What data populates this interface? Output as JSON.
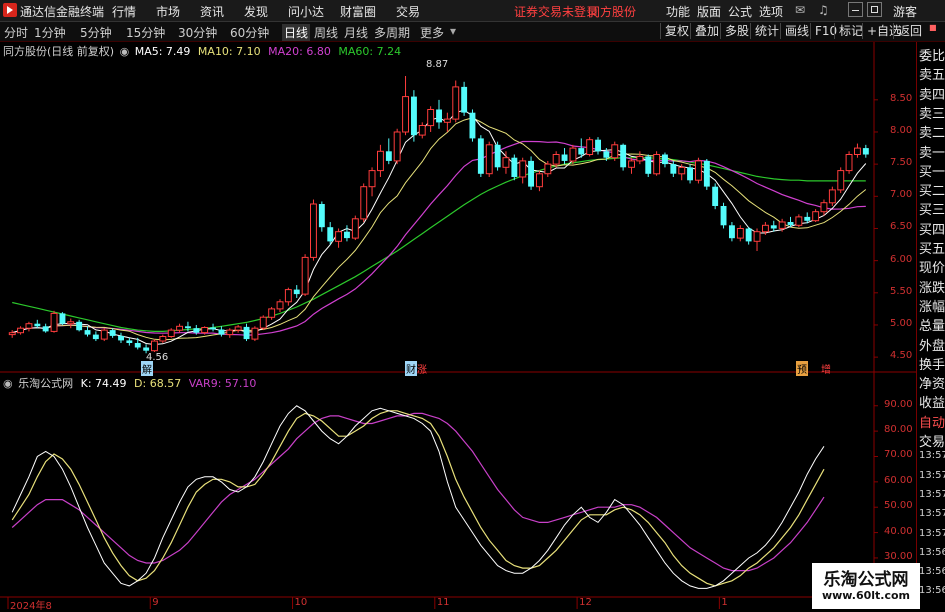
{
  "titlebar": {
    "app_name": "通达信金融终端",
    "menu": [
      "行情",
      "市场",
      "资讯",
      "发现",
      "问小达",
      "财富圈",
      "交易"
    ],
    "notice": "证券交易未登录",
    "stock": "同方股份",
    "right_menu": [
      "功能",
      "版面",
      "公式",
      "选项"
    ],
    "user": "游客"
  },
  "periodbar": {
    "periods": [
      "分时",
      "1分钟",
      "5分钟",
      "15分钟",
      "30分钟",
      "60分钟",
      "日线",
      "周线",
      "月线",
      "多周期",
      "更多"
    ],
    "active": "日线",
    "buttons": [
      "复权",
      "叠加",
      "多股",
      "统计",
      "画线",
      "F10",
      "标记",
      "+自选",
      "返回"
    ]
  },
  "main_legend": {
    "title": "同方股份(日线 前复权)",
    "ma5": "MA5: 7.49",
    "ma10": "MA10: 7.10",
    "ma20": "MA20: 6.80",
    "ma60": "MA60: 7.24"
  },
  "sub_legend": {
    "title": "乐淘公式网",
    "k": "K: 74.49",
    "d": "D: 68.57",
    "var9": "VAR9: 57.10"
  },
  "colors": {
    "up": "#ff3d3d",
    "down": "#54fcfc",
    "ma5": "#ffffff",
    "ma10": "#e6e07a",
    "ma20": "#d040d0",
    "ma60": "#2cc92c",
    "k": "#ffffff",
    "d": "#e8e07a",
    "var9": "#c840c8"
  },
  "right_panel": [
    "委比",
    "卖五",
    "卖四",
    "卖三",
    "卖二",
    "卖一",
    "买一",
    "买二",
    "买三",
    "买四",
    "买五",
    "现价",
    "涨跌",
    "涨幅",
    "总量",
    "外盘",
    "换手",
    "净资",
    "收益",
    "自动",
    "交易",
    "13:57",
    "13:57",
    "13:57",
    "13:57",
    "13:57",
    "13:56",
    "13:56",
    "13:56"
  ],
  "price_axis": [
    "8.50",
    "8.00",
    "7.50",
    "7.00",
    "6.50",
    "6.00",
    "5.50",
    "5.00",
    "4.50"
  ],
  "osc_axis": [
    "90.00",
    "80.00",
    "70.00",
    "60.00",
    "50.00",
    "40.00",
    "30.00"
  ],
  "date_axis": [
    "2024年8",
    "9",
    "10",
    "11",
    "12",
    "1"
  ],
  "annotations": {
    "high": "8.87",
    "low": "4.56",
    "marker_jie": "解",
    "marker_cai": "财",
    "marker_zhang": "涨",
    "marker_yu": "预",
    "marker_zeng": "增"
  },
  "watermark": {
    "line1": "乐淘公式网",
    "line2": "www.60lt.com"
  },
  "chart_data": {
    "type": "candlestick",
    "ylim": [
      4.3,
      9.15
    ],
    "osc_ylim": [
      15,
      97
    ],
    "candles": [
      [
        4.85,
        4.92,
        4.8,
        4.88
      ],
      [
        4.88,
        4.98,
        4.85,
        4.95
      ],
      [
        4.95,
        5.05,
        4.9,
        5.02
      ],
      [
        5.02,
        5.08,
        4.95,
        4.98
      ],
      [
        4.98,
        5.02,
        4.88,
        4.9
      ],
      [
        4.9,
        5.22,
        4.88,
        5.18
      ],
      [
        5.18,
        5.2,
        5.0,
        5.02
      ],
      [
        5.02,
        5.1,
        4.95,
        5.05
      ],
      [
        5.05,
        5.08,
        4.9,
        4.92
      ],
      [
        4.92,
        4.98,
        4.82,
        4.85
      ],
      [
        4.85,
        4.9,
        4.75,
        4.78
      ],
      [
        4.78,
        4.95,
        4.75,
        4.92
      ],
      [
        4.92,
        4.95,
        4.8,
        4.83
      ],
      [
        4.83,
        4.88,
        4.72,
        4.76
      ],
      [
        4.76,
        4.8,
        4.68,
        4.72
      ],
      [
        4.72,
        4.8,
        4.62,
        4.65
      ],
      [
        4.65,
        4.7,
        4.56,
        4.6
      ],
      [
        4.6,
        4.78,
        4.58,
        4.75
      ],
      [
        4.75,
        4.85,
        4.72,
        4.82
      ],
      [
        4.82,
        4.95,
        4.8,
        4.92
      ],
      [
        4.92,
        5.02,
        4.88,
        4.98
      ],
      [
        4.98,
        5.05,
        4.9,
        4.95
      ],
      [
        4.95,
        5.0,
        4.85,
        4.88
      ],
      [
        4.88,
        4.98,
        4.85,
        4.96
      ],
      [
        4.96,
        5.02,
        4.9,
        4.93
      ],
      [
        4.93,
        4.98,
        4.82,
        4.85
      ],
      [
        4.85,
        4.95,
        4.8,
        4.92
      ],
      [
        4.92,
        5.0,
        4.88,
        4.97
      ],
      [
        4.97,
        5.02,
        4.75,
        4.78
      ],
      [
        4.78,
        4.98,
        4.75,
        4.95
      ],
      [
        4.95,
        5.15,
        4.92,
        5.12
      ],
      [
        5.12,
        5.28,
        5.08,
        5.25
      ],
      [
        5.25,
        5.4,
        5.2,
        5.36
      ],
      [
        5.36,
        5.58,
        5.3,
        5.55
      ],
      [
        5.55,
        5.62,
        5.42,
        5.48
      ],
      [
        5.48,
        6.1,
        5.45,
        6.05
      ],
      [
        6.05,
        6.95,
        6.0,
        6.88
      ],
      [
        6.88,
        6.92,
        6.45,
        6.52
      ],
      [
        6.52,
        6.6,
        6.25,
        6.3
      ],
      [
        6.3,
        6.5,
        6.2,
        6.45
      ],
      [
        6.45,
        6.55,
        6.3,
        6.35
      ],
      [
        6.35,
        6.7,
        6.32,
        6.65
      ],
      [
        6.65,
        7.2,
        6.6,
        7.15
      ],
      [
        7.15,
        7.45,
        7.0,
        7.4
      ],
      [
        7.4,
        7.8,
        7.3,
        7.7
      ],
      [
        7.7,
        7.9,
        7.5,
        7.55
      ],
      [
        7.55,
        8.05,
        7.5,
        8.0
      ],
      [
        8.0,
        8.87,
        7.95,
        8.55
      ],
      [
        8.55,
        8.65,
        7.85,
        7.95
      ],
      [
        7.95,
        8.15,
        7.9,
        8.1
      ],
      [
        8.1,
        8.4,
        8.0,
        8.35
      ],
      [
        8.35,
        8.5,
        8.05,
        8.15
      ],
      [
        8.15,
        8.3,
        8.0,
        8.2
      ],
      [
        8.2,
        8.8,
        8.15,
        8.7
      ],
      [
        8.7,
        8.78,
        8.25,
        8.3
      ],
      [
        8.3,
        8.35,
        7.85,
        7.9
      ],
      [
        7.9,
        7.95,
        7.3,
        7.35
      ],
      [
        7.35,
        7.85,
        7.3,
        7.8
      ],
      [
        7.8,
        7.85,
        7.4,
        7.45
      ],
      [
        7.45,
        7.7,
        7.35,
        7.6
      ],
      [
        7.6,
        7.65,
        7.25,
        7.3
      ],
      [
        7.3,
        7.6,
        7.2,
        7.55
      ],
      [
        7.55,
        7.62,
        7.1,
        7.15
      ],
      [
        7.15,
        7.4,
        7.08,
        7.35
      ],
      [
        7.35,
        7.55,
        7.3,
        7.5
      ],
      [
        7.5,
        7.7,
        7.45,
        7.65
      ],
      [
        7.65,
        7.75,
        7.5,
        7.55
      ],
      [
        7.55,
        7.8,
        7.5,
        7.75
      ],
      [
        7.75,
        7.9,
        7.6,
        7.65
      ],
      [
        7.65,
        7.92,
        7.62,
        7.88
      ],
      [
        7.88,
        7.92,
        7.65,
        7.7
      ],
      [
        7.7,
        7.75,
        7.55,
        7.6
      ],
      [
        7.6,
        7.85,
        7.55,
        7.8
      ],
      [
        7.8,
        7.82,
        7.4,
        7.45
      ],
      [
        7.45,
        7.6,
        7.35,
        7.55
      ],
      [
        7.55,
        7.7,
        7.5,
        7.62
      ],
      [
        7.62,
        7.65,
        7.3,
        7.35
      ],
      [
        7.35,
        7.7,
        7.32,
        7.65
      ],
      [
        7.65,
        7.68,
        7.45,
        7.5
      ],
      [
        7.5,
        7.55,
        7.3,
        7.35
      ],
      [
        7.35,
        7.5,
        7.25,
        7.45
      ],
      [
        7.45,
        7.5,
        7.2,
        7.25
      ],
      [
        7.25,
        7.6,
        7.2,
        7.55
      ],
      [
        7.55,
        7.58,
        7.1,
        7.15
      ],
      [
        7.15,
        7.2,
        6.8,
        6.85
      ],
      [
        6.85,
        6.9,
        6.5,
        6.55
      ],
      [
        6.55,
        6.6,
        6.3,
        6.35
      ],
      [
        6.35,
        6.55,
        6.3,
        6.5
      ],
      [
        6.5,
        6.52,
        6.25,
        6.3
      ],
      [
        6.3,
        6.5,
        6.15,
        6.45
      ],
      [
        6.45,
        6.6,
        6.4,
        6.55
      ],
      [
        6.55,
        6.62,
        6.45,
        6.5
      ],
      [
        6.5,
        6.65,
        6.45,
        6.6
      ],
      [
        6.6,
        6.68,
        6.52,
        6.55
      ],
      [
        6.55,
        6.72,
        6.52,
        6.68
      ],
      [
        6.68,
        6.75,
        6.58,
        6.62
      ],
      [
        6.62,
        6.8,
        6.6,
        6.76
      ],
      [
        6.76,
        6.95,
        6.7,
        6.9
      ],
      [
        6.9,
        7.15,
        6.85,
        7.1
      ],
      [
        7.1,
        7.45,
        7.05,
        7.4
      ],
      [
        7.4,
        7.7,
        7.35,
        7.65
      ],
      [
        7.65,
        7.82,
        7.6,
        7.75
      ],
      [
        7.75,
        7.8,
        7.6,
        7.65
      ]
    ],
    "ma60": [
      5.35,
      5.32,
      5.29,
      5.26,
      5.23,
      5.2,
      5.17,
      5.14,
      5.11,
      5.08,
      5.05,
      5.02,
      4.99,
      4.96,
      4.94,
      4.92,
      4.91,
      4.9,
      4.9,
      4.91,
      4.92,
      4.93,
      4.94,
      4.95,
      4.96,
      4.98,
      5.0,
      5.02,
      5.04,
      5.07,
      5.1,
      5.14,
      5.18,
      5.23,
      5.28,
      5.34,
      5.4,
      5.47,
      5.54,
      5.61,
      5.68,
      5.75,
      5.83,
      5.91,
      5.99,
      6.07,
      6.15,
      6.24,
      6.33,
      6.42,
      6.51,
      6.6,
      6.69,
      6.78,
      6.87,
      6.95,
      7.03,
      7.1,
      7.16,
      7.22,
      7.27,
      7.32,
      7.36,
      7.4,
      7.44,
      7.47,
      7.5,
      7.52,
      7.54,
      7.56,
      7.57,
      7.58,
      7.59,
      7.6,
      7.6,
      7.6,
      7.6,
      7.59,
      7.58,
      7.57,
      7.55,
      7.53,
      7.51,
      7.49,
      7.46,
      7.43,
      7.4,
      7.37,
      7.34,
      7.31,
      7.29,
      7.27,
      7.26,
      7.25,
      7.25,
      7.24,
      7.24,
      7.24,
      7.24,
      7.24,
      7.24,
      7.24,
      7.24
    ],
    "k": [
      48,
      55,
      62,
      70,
      72,
      70,
      65,
      58,
      50,
      42,
      35,
      28,
      24,
      20,
      19,
      21,
      24,
      30,
      38,
      45,
      52,
      58,
      61,
      62,
      62,
      60,
      57,
      56,
      58,
      62,
      68,
      75,
      82,
      87,
      90,
      88,
      84,
      80,
      77,
      75,
      78,
      82,
      85,
      88,
      89,
      88,
      87,
      86,
      85,
      83,
      80,
      72,
      60,
      50,
      45,
      40,
      35,
      31,
      27,
      25,
      24,
      24,
      26,
      29,
      33,
      38,
      43,
      47,
      50,
      46,
      44,
      48,
      53,
      51,
      47,
      43,
      38,
      33,
      28,
      24,
      21,
      19,
      18,
      18,
      19,
      21,
      24,
      27,
      30,
      32,
      35,
      39,
      44,
      50,
      56,
      63,
      69,
      74
    ],
    "d": [
      45,
      50,
      55,
      62,
      68,
      71,
      69,
      65,
      59,
      52,
      45,
      38,
      32,
      27,
      23,
      21,
      22,
      25,
      30,
      36,
      43,
      50,
      56,
      59,
      61,
      61,
      60,
      58,
      58,
      59,
      63,
      68,
      74,
      80,
      85,
      87,
      86,
      84,
      81,
      78,
      78,
      80,
      82,
      85,
      87,
      88,
      88,
      87,
      86,
      85,
      83,
      78,
      70,
      61,
      54,
      48,
      42,
      37,
      33,
      29,
      27,
      26,
      26,
      27,
      30,
      33,
      37,
      41,
      45,
      47,
      47,
      47,
      49,
      50,
      49,
      47,
      44,
      40,
      36,
      31,
      27,
      24,
      22,
      20,
      19,
      20,
      21,
      23,
      26,
      28,
      31,
      34,
      38,
      42,
      47,
      53,
      59,
      65
    ],
    "var9": [
      42,
      45,
      48,
      51,
      53,
      53,
      53,
      51,
      49,
      46,
      43,
      40,
      37,
      34,
      31,
      29,
      28,
      28,
      29,
      31,
      33,
      36,
      40,
      44,
      48,
      52,
      55,
      57,
      59,
      61,
      64,
      67,
      70,
      73,
      77,
      80,
      83,
      85,
      86,
      86,
      85,
      84,
      83,
      83,
      84,
      85,
      86,
      86,
      87,
      87,
      86,
      85,
      83,
      80,
      76,
      72,
      67,
      62,
      57,
      53,
      49,
      46,
      45,
      44,
      44,
      45,
      46,
      47,
      48,
      49,
      50,
      50,
      50,
      51,
      51,
      50,
      48,
      46,
      43,
      40,
      37,
      34,
      32,
      30,
      28,
      26,
      25,
      25,
      25,
      26,
      28,
      30,
      33,
      36,
      40,
      44,
      49,
      54
    ]
  }
}
